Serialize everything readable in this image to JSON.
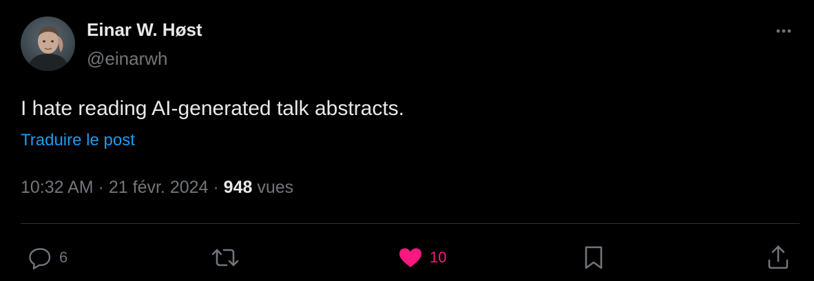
{
  "author": {
    "display_name": "Einar W. Høst",
    "handle": "@einarwh"
  },
  "post": {
    "text": "I hate reading AI-generated talk abstracts.",
    "translate_label": "Traduire le post"
  },
  "meta": {
    "time": "10:32 AM",
    "separator": "·",
    "date": "21 févr. 2024",
    "views_count": "948",
    "views_label": "vues"
  },
  "actions": {
    "reply_count": "6",
    "repost_count": "",
    "like_count": "10",
    "liked": true
  },
  "icons": {
    "more": "more-horizontal-icon",
    "reply": "speech-bubble-icon",
    "repost": "repost-arrows-icon",
    "like": "heart-filled-icon",
    "bookmark": "bookmark-icon",
    "share": "share-upload-icon"
  },
  "colors": {
    "background": "#000000",
    "text_primary": "#e7e9ea",
    "text_secondary": "#71767b",
    "link": "#1d9bf0",
    "like": "#f91880",
    "divider": "#2f3336"
  }
}
